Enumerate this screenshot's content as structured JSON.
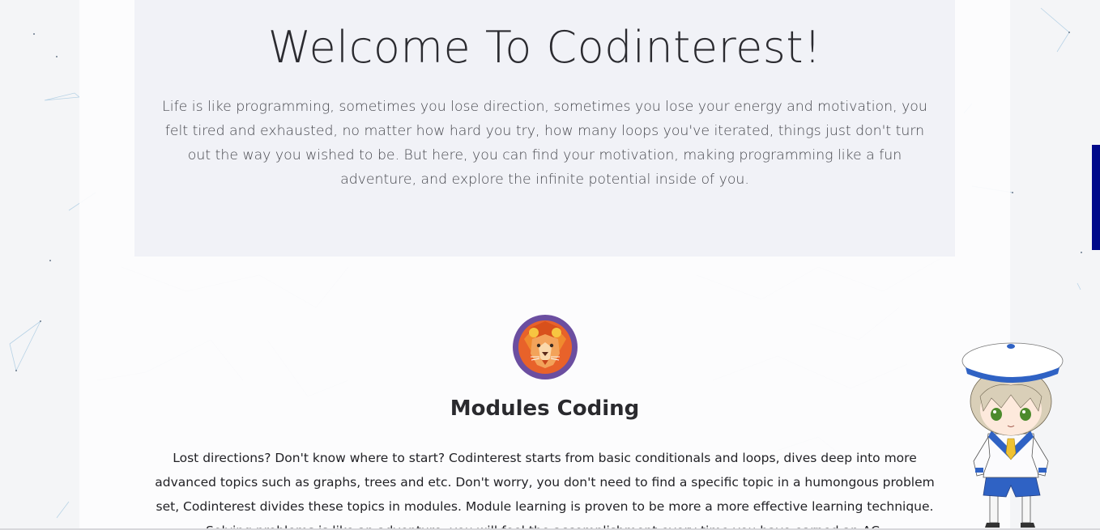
{
  "hero": {
    "title": "Welcome To Codinterest!",
    "text": "Life is like programming, sometimes you lose direction, sometimes you lose your energy and motivation, you felt tired and exhausted, no matter how hard you try, how many loops you've iterated, things just don't turn out the way you wished to be. But here, you can find your motivation, making programming like a fun adventure, and explore the infinite potential inside of you."
  },
  "module": {
    "icon": "lion-icon",
    "title": "Modules Coding",
    "text": "Lost directions? Don't know where to start? Codinterest starts from basic conditionals and loops, dives deep into more advanced topics such as graphs, trees and etc. Don't worry, you don't need to find a specific topic in a humongous problem set, Codinterest divides these topics in modules. Module learning is proven to be more a more effective learning technique. Solving problems is like an adventure, you will feel the accomplishment every time you have earned an AC."
  },
  "colors": {
    "hero_bg": "#f1f2f7",
    "side_tab": "#000a8a",
    "icon_circle": "#6b4ea0",
    "lion_orange": "#e8622a"
  },
  "decorations": {
    "background": "network-lines",
    "mascot": "sailor-mascot"
  }
}
